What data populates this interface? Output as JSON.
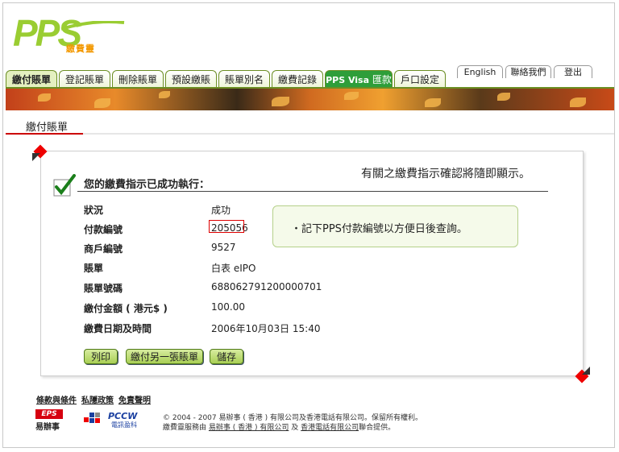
{
  "logo": {
    "text": "PPS",
    "subtitle": "繳費靈"
  },
  "nav": {
    "tabs": [
      {
        "label": "繳付賬單",
        "active": true
      },
      {
        "label": "登記賬單"
      },
      {
        "label": "刪除賬單"
      },
      {
        "label": "預設繳賬"
      },
      {
        "label": "賬單別名"
      },
      {
        "label": "繳費記錄"
      },
      {
        "label_en": "PPS Visa",
        "label_zh": "匯款"
      },
      {
        "label": "戶口設定"
      }
    ],
    "utility": [
      "English",
      "聯絡我們",
      "登出"
    ]
  },
  "page_title": "繳付賬單",
  "notice": "有關之繳費指示確認將隨即顯示。",
  "confirmation": {
    "heading": "您的繳費指示已成功執行：",
    "rows": [
      {
        "label": "狀況",
        "value": "成功"
      },
      {
        "label": "付款編號",
        "value": "205056"
      },
      {
        "label": "商戶編號",
        "value": "9527"
      },
      {
        "label": "賬單",
        "value": "白表 eIPO"
      },
      {
        "label": "賬單號碼",
        "value": "688062791200000701"
      },
      {
        "label": "繳付金額 ( 港元$ )",
        "value": "100.00"
      },
      {
        "label": "繳費日期及時間",
        "value": "2006年10月03日 15:40"
      }
    ]
  },
  "tip": "・記下PPS付款編號以方便日後查詢。",
  "buttons": {
    "print": "列印",
    "pay_another": "繳付另一張賬單",
    "save": "儲存"
  },
  "footer": {
    "links": [
      "條款與條件",
      "私隱政策",
      "免責聲明"
    ],
    "eps_logo": "EPS",
    "eps_logo_sub": "易辦事",
    "pccw_logo": "PCCW",
    "pccw_logo_sub": "電訊盈科",
    "copyright": "© 2004 - 2007 易辦事 ( 香港 ) 有限公司及香港電話有限公司。保留所有權利。",
    "service_prefix": "繳費靈服務由",
    "service_company1": "易辦事 ( 香港 ) 有限公司",
    "service_and": "及",
    "service_company2": "香港電話有限公司",
    "service_suffix": "聯合提供。"
  },
  "colors": {
    "accent_green": "#9acd32",
    "brand_orange": "#f39800",
    "visa_green": "#2e9e3a",
    "highlight_red": "#dd0000"
  }
}
